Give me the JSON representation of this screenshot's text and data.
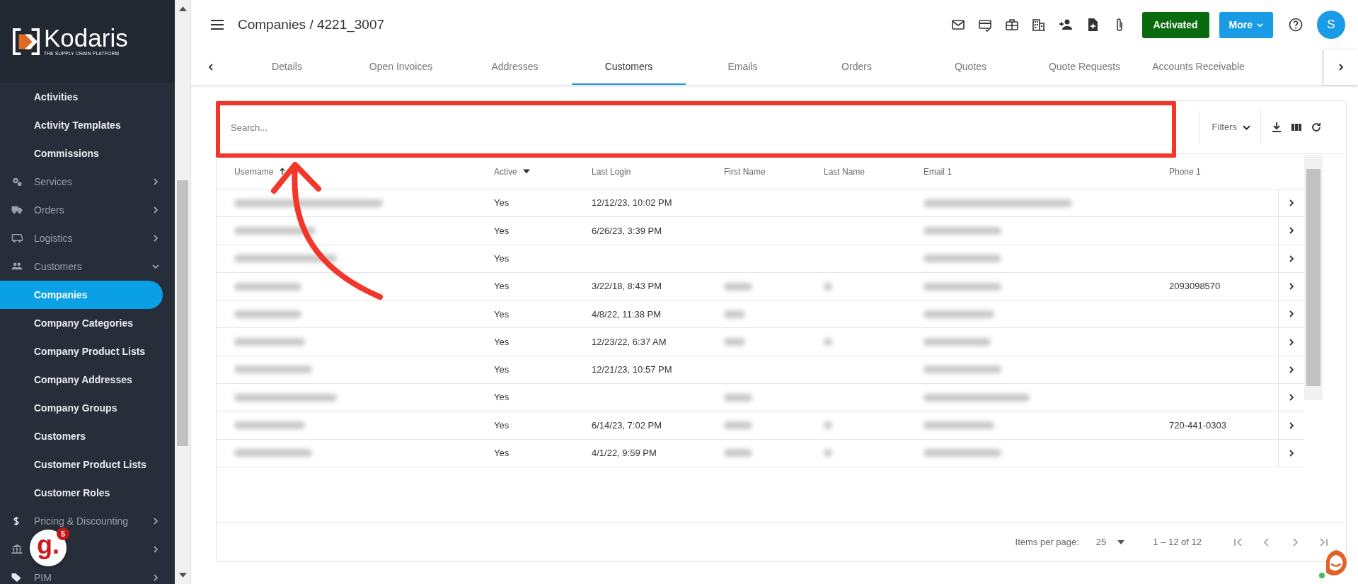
{
  "sidebar": {
    "logo": {
      "name": "Kodaris",
      "tagline": "THE SUPPLY CHAIN PLATFORM"
    },
    "items": [
      {
        "kind": "sub",
        "label": "Activities",
        "selected": false
      },
      {
        "kind": "sub",
        "label": "Activity Templates",
        "selected": false
      },
      {
        "kind": "sub",
        "label": "Commissions",
        "selected": false
      },
      {
        "kind": "group",
        "label": "Services",
        "expanded": false
      },
      {
        "kind": "group",
        "label": "Orders",
        "expanded": false
      },
      {
        "kind": "group",
        "label": "Logistics",
        "expanded": false
      },
      {
        "kind": "group",
        "label": "Customers",
        "expanded": true
      },
      {
        "kind": "sub",
        "label": "Companies",
        "selected": true
      },
      {
        "kind": "sub",
        "label": "Company Categories",
        "selected": false
      },
      {
        "kind": "sub",
        "label": "Company Product Lists",
        "selected": false
      },
      {
        "kind": "sub",
        "label": "Company Addresses",
        "selected": false
      },
      {
        "kind": "sub",
        "label": "Company Groups",
        "selected": false
      },
      {
        "kind": "sub",
        "label": "Customers",
        "selected": false
      },
      {
        "kind": "sub",
        "label": "Customer Product Lists",
        "selected": false
      },
      {
        "kind": "sub",
        "label": "Customer Roles",
        "selected": false
      },
      {
        "kind": "group",
        "label": "Pricing & Discounting",
        "expanded": false
      },
      {
        "kind": "group",
        "expanded": false
      },
      {
        "kind": "group",
        "label": "PIM",
        "expanded": false
      }
    ],
    "widget": {
      "label": "g.",
      "badge": "5"
    }
  },
  "header": {
    "title": "Companies / 4221_3007",
    "status_button": "Activated",
    "more_button": "More",
    "avatar": "S"
  },
  "tabs": [
    {
      "label": "Details",
      "selected": false
    },
    {
      "label": "Open Invoices",
      "selected": false
    },
    {
      "label": "Addresses",
      "selected": false
    },
    {
      "label": "Customers",
      "selected": true
    },
    {
      "label": "Emails",
      "selected": false
    },
    {
      "label": "Orders",
      "selected": false
    },
    {
      "label": "Quotes",
      "selected": false
    },
    {
      "label": "Quote Requests",
      "selected": false
    },
    {
      "label": "Accounts Receivable",
      "selected": false
    }
  ],
  "search": {
    "placeholder": "Search..."
  },
  "filters": "Filters",
  "table": {
    "columns": [
      {
        "kind": "sorted",
        "label": "Username"
      },
      {
        "kind": "menu",
        "label": "Active"
      },
      {
        "kind": "plain",
        "label": "Last Login"
      },
      {
        "kind": "plain",
        "label": "First Name"
      },
      {
        "kind": "plain",
        "label": "Last Name"
      },
      {
        "kind": "plain",
        "label": "Email 1"
      },
      {
        "kind": "plain",
        "label": "Phone 1"
      }
    ],
    "rows": [
      [
        {
          "kind": "redacted"
        },
        {
          "kind": "text",
          "text": "Yes"
        },
        {
          "kind": "text",
          "text": "12/12/23, 10:02 PM"
        },
        {
          "kind": "blank"
        },
        {
          "kind": "blank"
        },
        {
          "kind": "redacted"
        },
        {
          "kind": "blank"
        }
      ],
      [
        {
          "kind": "redacted"
        },
        {
          "kind": "text",
          "text": "Yes"
        },
        {
          "kind": "text",
          "text": "6/26/23, 3:39 PM"
        },
        {
          "kind": "blank"
        },
        {
          "kind": "blank"
        },
        {
          "kind": "redacted"
        },
        {
          "kind": "blank"
        }
      ],
      [
        {
          "kind": "redacted"
        },
        {
          "kind": "text",
          "text": "Yes"
        },
        {
          "kind": "blank"
        },
        {
          "kind": "blank"
        },
        {
          "kind": "blank"
        },
        {
          "kind": "redacted"
        },
        {
          "kind": "blank"
        }
      ],
      [
        {
          "kind": "redacted"
        },
        {
          "kind": "text",
          "text": "Yes"
        },
        {
          "kind": "text",
          "text": "3/22/18, 8:43 PM"
        },
        {
          "kind": "redacted"
        },
        {
          "kind": "redacted"
        },
        {
          "kind": "redacted"
        },
        {
          "kind": "text",
          "text": "2093098570"
        }
      ],
      [
        {
          "kind": "redacted"
        },
        {
          "kind": "text",
          "text": "Yes"
        },
        {
          "kind": "text",
          "text": "4/8/22, 11:38 PM"
        },
        {
          "kind": "redacted"
        },
        {
          "kind": "blank"
        },
        {
          "kind": "redacted"
        },
        {
          "kind": "blank"
        }
      ],
      [
        {
          "kind": "redacted"
        },
        {
          "kind": "text",
          "text": "Yes"
        },
        {
          "kind": "text",
          "text": "12/23/22, 6:37 AM"
        },
        {
          "kind": "redacted"
        },
        {
          "kind": "redacted"
        },
        {
          "kind": "redacted"
        },
        {
          "kind": "blank"
        }
      ],
      [
        {
          "kind": "redacted"
        },
        {
          "kind": "text",
          "text": "Yes"
        },
        {
          "kind": "text",
          "text": "12/21/23, 10:57 PM"
        },
        {
          "kind": "blank"
        },
        {
          "kind": "blank"
        },
        {
          "kind": "redacted"
        },
        {
          "kind": "blank"
        }
      ],
      [
        {
          "kind": "redacted"
        },
        {
          "kind": "text",
          "text": "Yes"
        },
        {
          "kind": "blank"
        },
        {
          "kind": "redacted"
        },
        {
          "kind": "blank"
        },
        {
          "kind": "redacted"
        },
        {
          "kind": "blank"
        }
      ],
      [
        {
          "kind": "redacted"
        },
        {
          "kind": "text",
          "text": "Yes"
        },
        {
          "kind": "text",
          "text": "6/14/23, 7:02 PM"
        },
        {
          "kind": "redacted"
        },
        {
          "kind": "redacted"
        },
        {
          "kind": "redacted"
        },
        {
          "kind": "text",
          "text": "720-441-0303"
        }
      ],
      [
        {
          "kind": "redacted"
        },
        {
          "kind": "text",
          "text": "Yes"
        },
        {
          "kind": "text",
          "text": "4/1/22, 9:59 PM"
        },
        {
          "kind": "redacted"
        },
        {
          "kind": "redacted"
        },
        {
          "kind": "redacted"
        },
        {
          "kind": "blank"
        }
      ]
    ]
  },
  "paginator": {
    "label": "Items per page:",
    "page_size": "25",
    "range": "1 – 12 of 12"
  }
}
